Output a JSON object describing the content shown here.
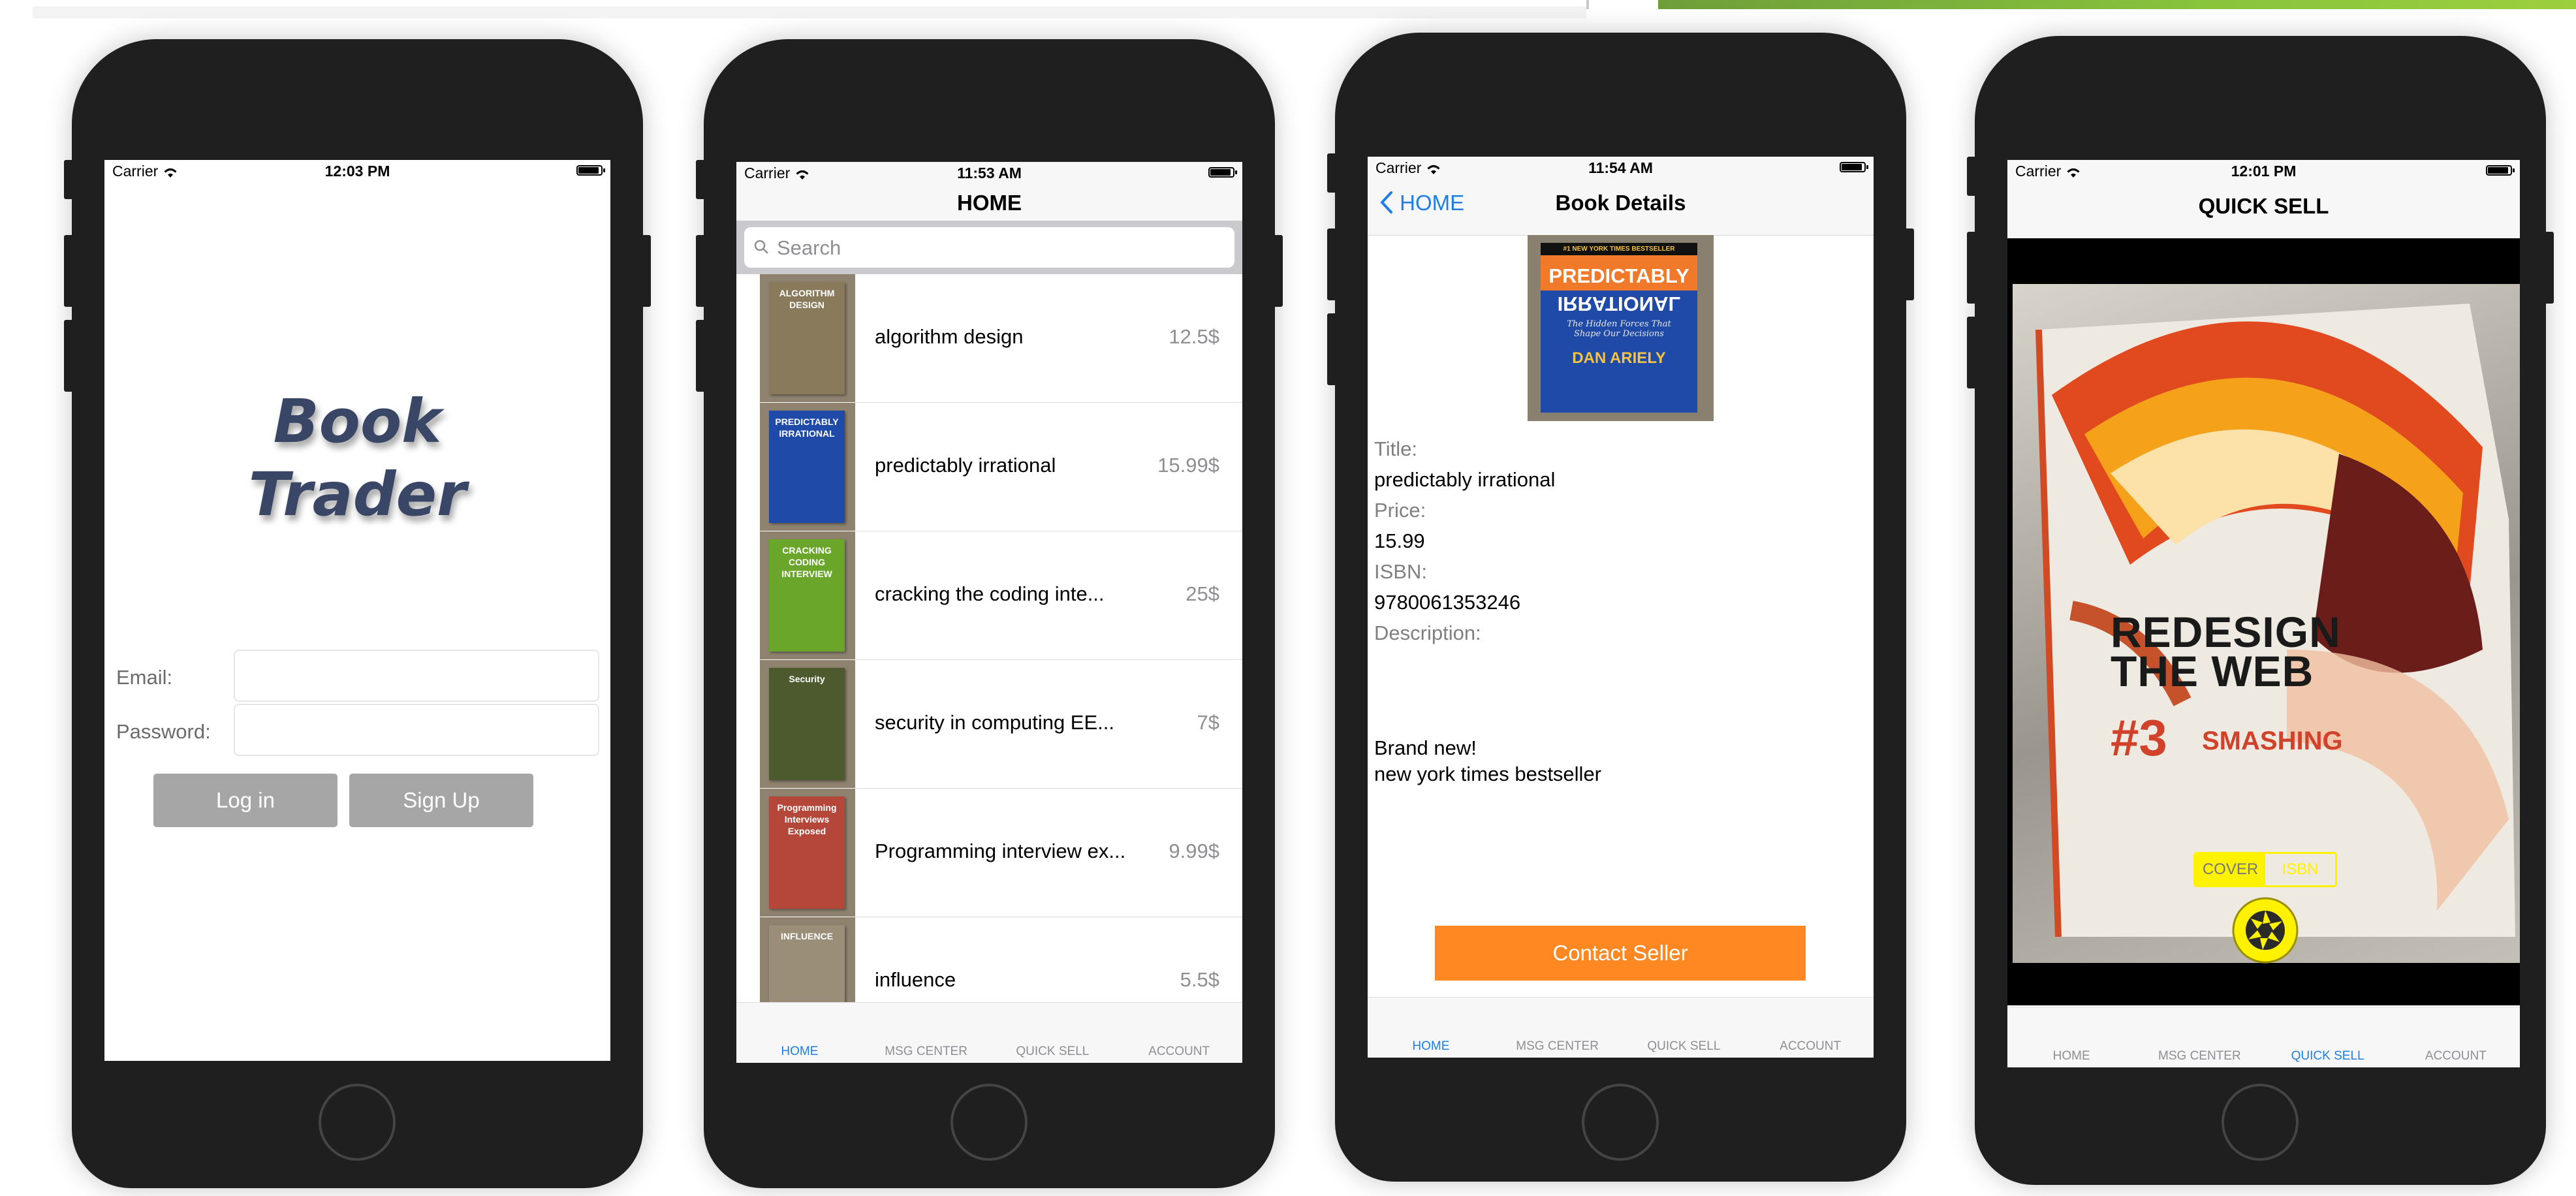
{
  "status": {
    "carrier": "Carrier"
  },
  "tabs": [
    "HOME",
    "MSG CENTER",
    "QUICK SELL",
    "ACCOUNT"
  ],
  "colors": {
    "accent": "#1e7ee6",
    "contact": "#ff8823",
    "gray_button": "#a6a6a6",
    "scan_yellow": "#fff200"
  },
  "login": {
    "time": "12:03 PM",
    "logo_line1": "Book",
    "logo_line2": "Trader",
    "email_label": "Email:",
    "password_label": "Password:",
    "email_value": "",
    "password_value": "",
    "login_button": "Log in",
    "signup_button": "Sign Up"
  },
  "home": {
    "time": "11:53 AM",
    "title": "HOME",
    "search_placeholder": "Search",
    "books": [
      {
        "title": "algorithm design",
        "price": "12.5$",
        "cover_text": "ALGORITHM DESIGN",
        "cover_color": "#8a7a5c"
      },
      {
        "title": "predictably irrational",
        "price": "15.99$",
        "cover_text": "PREDICTABLY IRRATIONAL",
        "cover_color": "#1f4aa8"
      },
      {
        "title": "cracking the coding inte...",
        "price": "25$",
        "cover_text": "CRACKING CODING INTERVIEW",
        "cover_color": "#6aa62a"
      },
      {
        "title": "security in computing EE...",
        "price": "7$",
        "cover_text": "Security",
        "cover_color": "#4d5a2e"
      },
      {
        "title": "Programming interview ex...",
        "price": "9.99$",
        "cover_text": "Programming Interviews Exposed",
        "cover_color": "#b5473a"
      },
      {
        "title": "influence",
        "price": "5.5$",
        "cover_text": "INFLUENCE",
        "cover_color": "#9a8e78"
      }
    ]
  },
  "details": {
    "time": "11:54 AM",
    "back_label": "HOME",
    "title": "Book Details",
    "cover_top": "#1 NEW YORK TIMES BESTSELLER",
    "cover_title1": "PREDICTABLY",
    "cover_title2": "IRRATIONAL",
    "cover_subtitle": "The Hidden Forces That Shape Our Decisions",
    "cover_author": "DAN ARIELY",
    "title_label": "Title:",
    "title_value": "predictably irrational",
    "price_label": "Price:",
    "price_value": "15.99",
    "isbn_label": "ISBN:",
    "isbn_value": "9780061353246",
    "description_label": "Description:",
    "description_line1": "Brand new!",
    "description_line2": "new york times bestseller",
    "contact_button": "Contact Seller"
  },
  "quicksell": {
    "time": "12:01 PM",
    "title": "QUICK SELL",
    "book_line1": "REDESIGN",
    "book_line2": "THE WEB",
    "book_number": "#3",
    "book_brand": "SMASHING",
    "mode_cover": "COVER",
    "mode_isbn": "ISBN"
  }
}
